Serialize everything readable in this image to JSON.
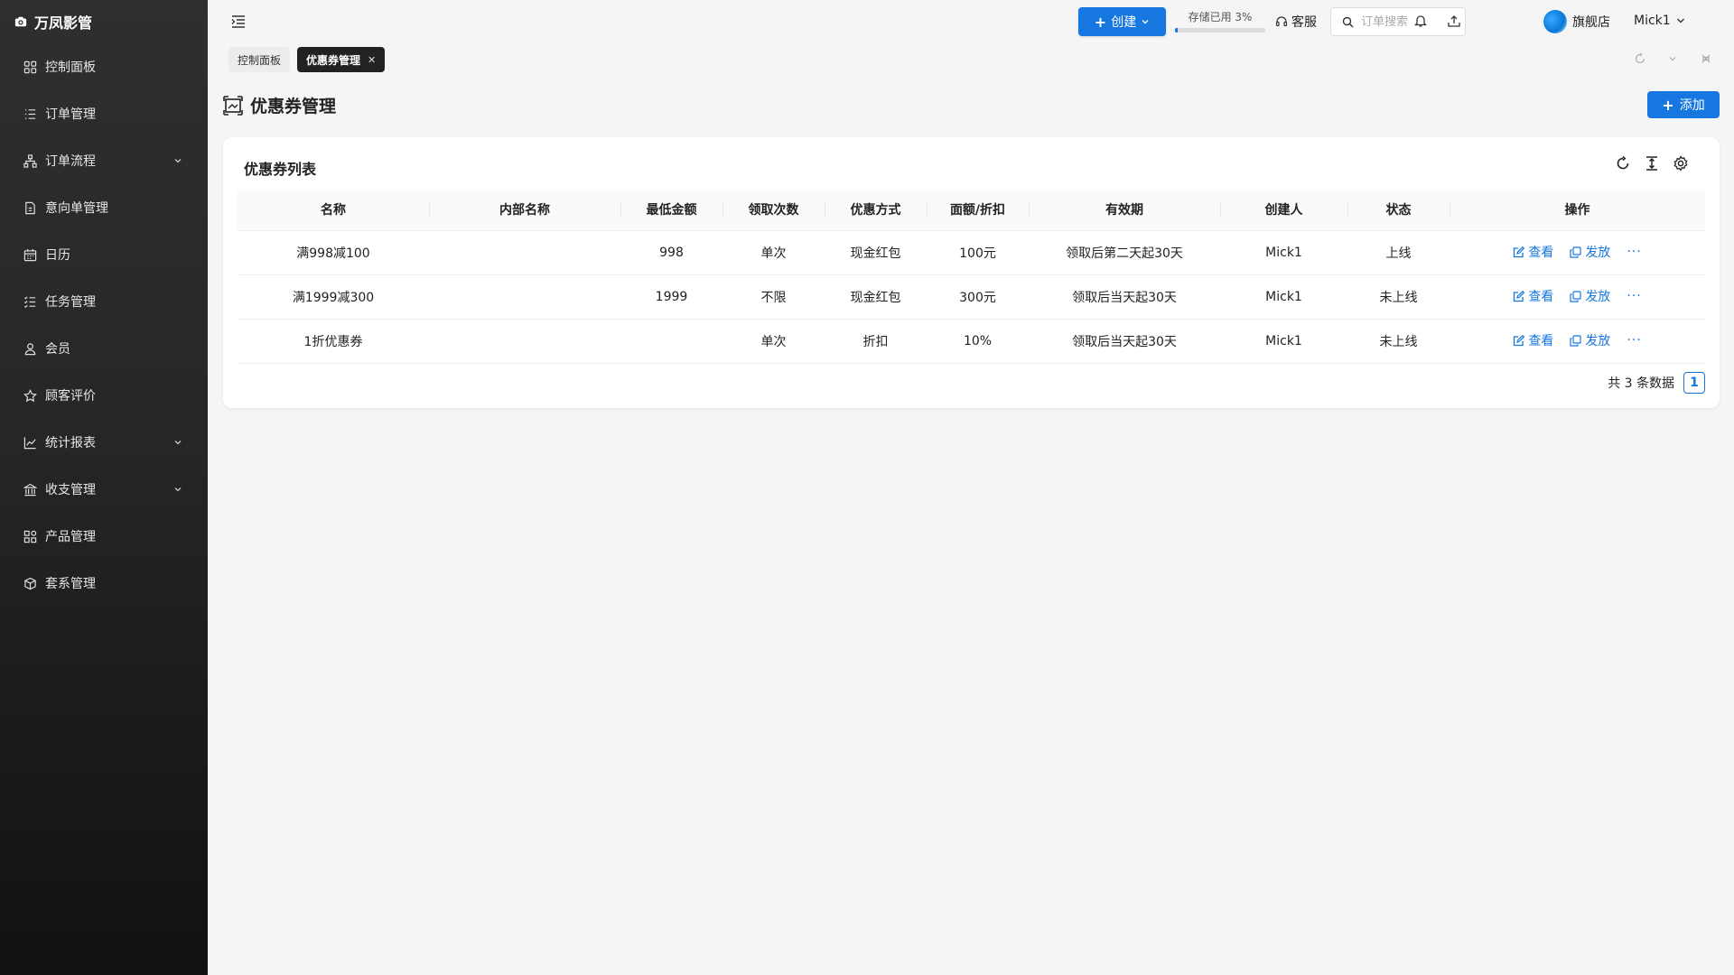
{
  "app": {
    "title": "万凤影管"
  },
  "sidebar": {
    "items": [
      {
        "label": "控制面板",
        "icon": "dashboard-icon",
        "expandable": false
      },
      {
        "label": "订单管理",
        "icon": "list-icon",
        "expandable": false
      },
      {
        "label": "订单流程",
        "icon": "flow-icon",
        "expandable": true
      },
      {
        "label": "意向单管理",
        "icon": "document-icon",
        "expandable": false
      },
      {
        "label": "日历",
        "icon": "calendar-icon",
        "expandable": false
      },
      {
        "label": "任务管理",
        "icon": "tasks-icon",
        "expandable": false
      },
      {
        "label": "会员",
        "icon": "user-icon",
        "expandable": false
      },
      {
        "label": "顾客评价",
        "icon": "star-icon",
        "expandable": false
      },
      {
        "label": "统计报表",
        "icon": "chart-icon",
        "expandable": true
      },
      {
        "label": "收支管理",
        "icon": "bank-icon",
        "expandable": true
      },
      {
        "label": "产品管理",
        "icon": "grid-icon",
        "expandable": false
      },
      {
        "label": "套系管理",
        "icon": "box-icon",
        "expandable": false
      }
    ]
  },
  "header": {
    "create_label": "创建",
    "storage_label": "存储已用 3%",
    "storage_percent": 3,
    "service_label": "客服",
    "search_placeholder": "订单搜索",
    "store_label": "旗舰店",
    "user_label": "Mick1"
  },
  "tabs": [
    {
      "label": "控制面板",
      "active": false
    },
    {
      "label": "优惠券管理",
      "active": true
    }
  ],
  "page": {
    "title": "优惠券管理",
    "add_label": "添加"
  },
  "table": {
    "title": "优惠券列表",
    "columns": [
      "名称",
      "内部名称",
      "最低金额",
      "领取次数",
      "优惠方式",
      "面额/折扣",
      "有效期",
      "创建人",
      "状态",
      "操作"
    ],
    "rows": [
      [
        "满998减100",
        "",
        "998",
        "单次",
        "现金红包",
        "100元",
        "领取后第二天起30天",
        "Mick1",
        "上线"
      ],
      [
        "满1999减300",
        "",
        "1999",
        "不限",
        "现金红包",
        "300元",
        "领取后当天起30天",
        "Mick1",
        "未上线"
      ],
      [
        "1折优惠券",
        "",
        "",
        "单次",
        "折扣",
        "10%",
        "领取后当天起30天",
        "Mick1",
        "未上线"
      ]
    ],
    "action_view": "查看",
    "action_issue": "发放",
    "action_more": "···"
  },
  "pagination": {
    "total_text": "共 3 条数据",
    "current_page": "1"
  },
  "colors": {
    "primary": "#1677e0",
    "sidebar_bg": "#2b2b2b"
  }
}
